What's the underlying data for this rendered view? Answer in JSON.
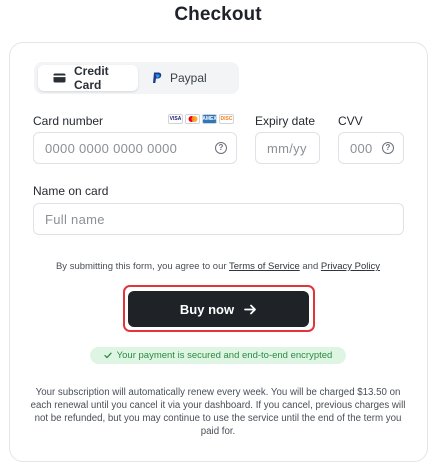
{
  "page": {
    "title": "Checkout"
  },
  "tabs": [
    {
      "label": "Credit Card",
      "icon": "credit-card-icon",
      "active": true
    },
    {
      "label": "Paypal",
      "icon": "paypal-icon",
      "active": false
    }
  ],
  "card_number": {
    "label": "Card number",
    "placeholder": "0000 0000 0000 0000"
  },
  "card_brands": [
    {
      "name": "VISA",
      "icon": "visa-icon",
      "color": "#1a1f71"
    },
    {
      "name": "Mastercard",
      "icon": "mastercard-icon",
      "color": "#eb001b"
    },
    {
      "name": "AMEX",
      "icon": "amex-icon",
      "color": "#2e77bc"
    },
    {
      "name": "Discover",
      "icon": "discover-icon",
      "color": "#f58220"
    }
  ],
  "expiry": {
    "label": "Expiry date",
    "placeholder": "mm/yy"
  },
  "cvv": {
    "label": "CVV",
    "placeholder": "000"
  },
  "name_on_card": {
    "label": "Name on card",
    "placeholder": "Full name"
  },
  "agreement": {
    "prefix": "By submitting this form, you agree to our ",
    "terms_link": "Terms of Service",
    "middle": " and ",
    "privacy_link": "Privacy Policy"
  },
  "buy_button": {
    "label": "Buy now",
    "icon": "arrow-right-icon"
  },
  "secure_badge": {
    "text": "Your payment is secured and end-to-end encrypted",
    "icon": "check-icon",
    "color": "#2a8a42"
  },
  "subscription_terms": "Your subscription will automatically renew every week. You will be charged $13.50 on each renewal until you cancel it via your dashboard. If you cancel, previous charges will not be refunded, but you may continue to use the service until the end of the term you paid for."
}
